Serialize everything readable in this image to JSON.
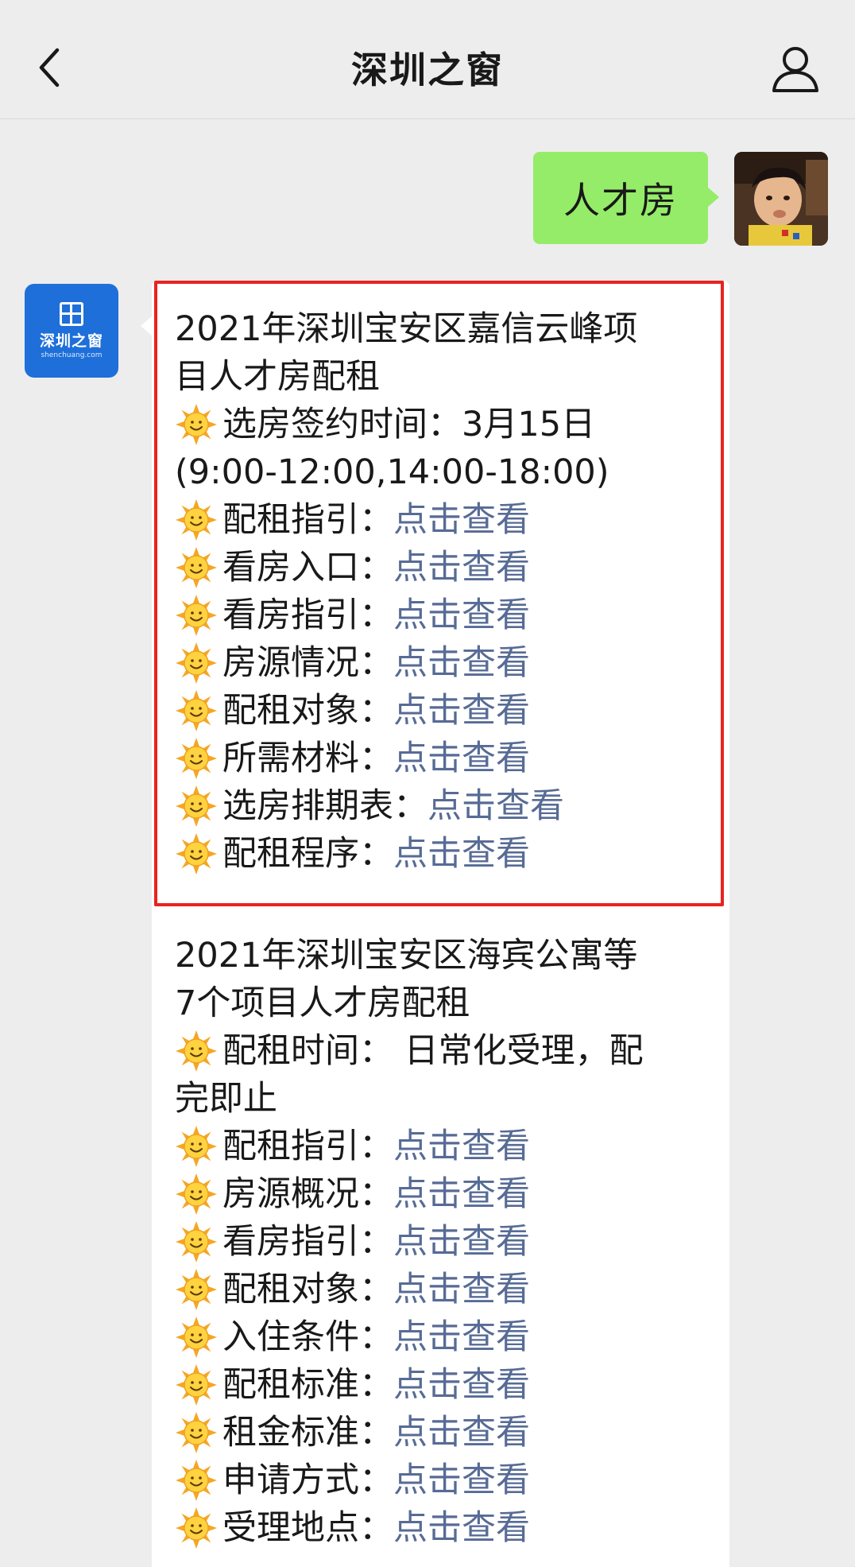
{
  "header": {
    "title": "深圳之窗"
  },
  "outgoing_message": {
    "text": "人才房"
  },
  "official_account": {
    "logo_text": "深圳之窗",
    "logo_subtext": "shenchuang.com"
  },
  "colors": {
    "outgoing_bubble": "#95ec69",
    "link": "#576b95",
    "highlight_border": "#e8231f",
    "oa_avatar": "#1e6fd9"
  },
  "reply": {
    "block1": {
      "title_line1": "2021年深圳宝安区嘉信云峰项",
      "title_line2": "目人才房配租",
      "time_label": "选房签约时间：",
      "time_value": "3月15日",
      "time_detail": "(9:00-12:00,14:00-18:00)",
      "items": [
        {
          "label": "配租指引：",
          "link": "点击查看"
        },
        {
          "label": "看房入口：",
          "link": "点击查看"
        },
        {
          "label": "看房指引：",
          "link": "点击查看"
        },
        {
          "label": "房源情况：",
          "link": "点击查看"
        },
        {
          "label": "配租对象：",
          "link": "点击查看"
        },
        {
          "label": "所需材料：",
          "link": "点击查看"
        },
        {
          "label": "选房排期表：",
          "link": "点击查看"
        },
        {
          "label": "配租程序：",
          "link": "点击查看"
        }
      ]
    },
    "block2": {
      "title_line1": "2021年深圳宝安区海宾公寓等",
      "title_line2": "7个项目人才房配租",
      "time_line1": "配租时间： 日常化受理，配",
      "time_line2": "完即止",
      "items": [
        {
          "label": "配租指引：",
          "link": "点击查看"
        },
        {
          "label": "房源概况：",
          "link": "点击查看"
        },
        {
          "label": "看房指引：",
          "link": "点击查看"
        },
        {
          "label": "配租对象：",
          "link": "点击查看"
        },
        {
          "label": "入住条件：",
          "link": "点击查看"
        },
        {
          "label": "配租标准：",
          "link": "点击查看"
        },
        {
          "label": "租金标准：",
          "link": "点击查看"
        },
        {
          "label": "申请方式：",
          "link": "点击查看"
        },
        {
          "label": "受理地点：",
          "link": "点击查看"
        }
      ]
    }
  }
}
